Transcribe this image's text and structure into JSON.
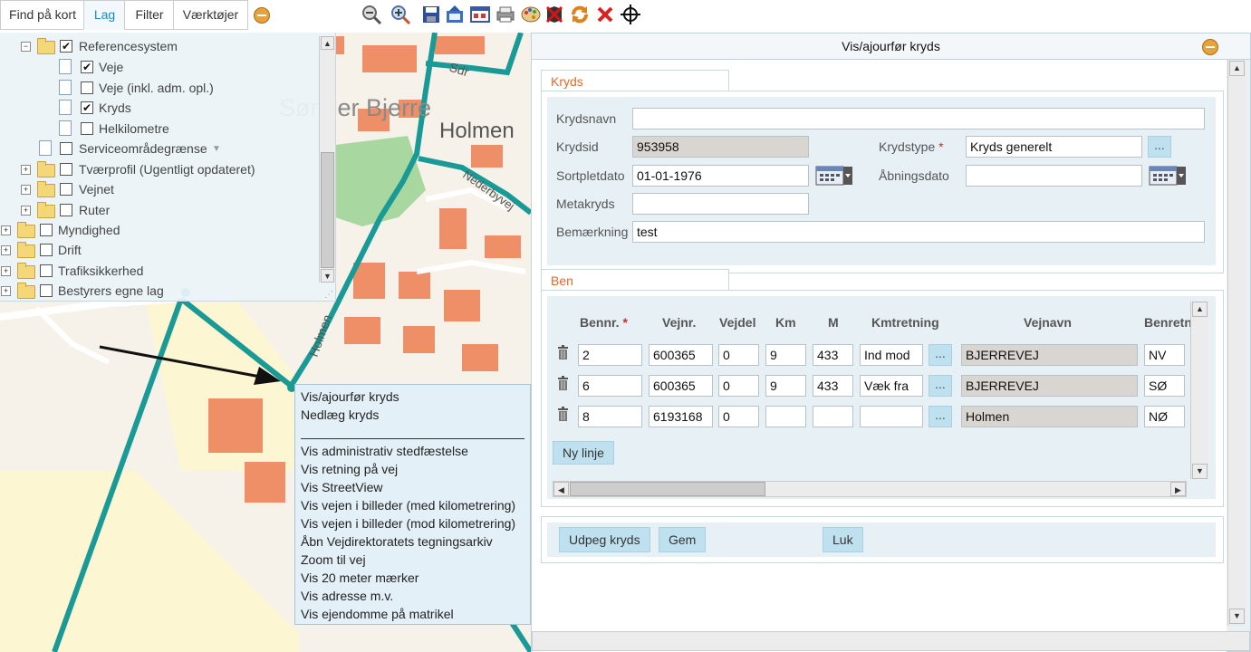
{
  "toolbar": {
    "tabs": [
      {
        "label": "Find på kort",
        "active": false
      },
      {
        "label": "Lag",
        "active": true
      },
      {
        "label": "Filter",
        "active": false
      },
      {
        "label": "Værktøjer",
        "active": false
      }
    ],
    "tools": [
      "zoom-out-icon",
      "zoom-in-icon",
      "save-icon",
      "export-icon",
      "table-icon",
      "print-icon",
      "palette-icon",
      "clear-icon",
      "refresh-icon",
      "close-red-icon",
      "crosshair-icon"
    ]
  },
  "map": {
    "labels": [
      {
        "text": "Sønder Bjerre"
      },
      {
        "text": "Holmen"
      },
      {
        "text": "Sdr"
      },
      {
        "text": "Holmen"
      },
      {
        "text": "Nederbyvej"
      }
    ]
  },
  "layers": [
    {
      "label": "Referencesystem",
      "checked": true
    },
    {
      "label": "Veje",
      "checked": true
    },
    {
      "label": "Veje (inkl. adm. opl.)",
      "checked": false
    },
    {
      "label": "Kryds",
      "checked": true
    },
    {
      "label": "Helkilometre",
      "checked": false
    },
    {
      "label": "Serviceområdegrænse",
      "checked": false
    },
    {
      "label": "Tværprofil (Ugentligt opdateret)",
      "checked": false
    },
    {
      "label": "Vejnet",
      "checked": false
    },
    {
      "label": "Ruter",
      "checked": false
    },
    {
      "label": "Myndighed",
      "checked": false
    },
    {
      "label": "Drift",
      "checked": false
    },
    {
      "label": "Trafiksikkerhed",
      "checked": false
    },
    {
      "label": "Bestyrers egne lag",
      "checked": false
    }
  ],
  "context_menu": {
    "items": [
      "Vis/ajourfør kryds",
      "Nedlæg kryds",
      "Vis administrativ stedfæstelse",
      "Vis retning på vej",
      "Vis StreetView",
      "Vis vejen i billeder (med kilometrering)",
      "Vis vejen i billeder (mod kilometrering)",
      "Åbn Vejdirektoratets tegningsarkiv",
      "Zoom til vej",
      "Vis 20 meter mærker",
      "Vis adresse m.v.",
      "Vis ejendomme på matrikel"
    ]
  },
  "dialog": {
    "title": "Vis/ajourfør kryds",
    "kryds": {
      "tab_label": "Kryds",
      "krydsnavn_label": "Krydsnavn",
      "krydsnavn_value": "",
      "krydsid_label": "Krydsid",
      "krydsid_value": "953958",
      "krydstype_label": "Krydstype",
      "krydstype_value": "Kryds generelt",
      "sortpletdato_label": "Sortpletdato",
      "sortpletdato_value": "01-01-1976",
      "abningsdato_label": "Åbningsdato",
      "abningsdato_value": "",
      "metakryds_label": "Metakryds",
      "metakryds_value": "",
      "bemaerkning_label": "Bemærkning",
      "bemaerkning_value": "test",
      "required_mark": "*",
      "dots": "..."
    },
    "ben": {
      "tab_label": "Ben",
      "headers": [
        "Bennr.",
        "Vejnr.",
        "Vejdel",
        "Km",
        "M",
        "Kmtretning",
        "Vejnavn",
        "Benretn"
      ],
      "required_mark": "*",
      "dots": "...",
      "rows": [
        {
          "bennr": "2",
          "vejnr": "600365",
          "vejdel": "0",
          "km": "9",
          "m": "433",
          "kmtretning": "Ind mod",
          "vejnavn": "BJERREVEJ",
          "benretning": "NV"
        },
        {
          "bennr": "6",
          "vejnr": "600365",
          "vejdel": "0",
          "km": "9",
          "m": "433",
          "kmtretning": "Væk fra",
          "vejnavn": "BJERREVEJ",
          "benretning": "SØ"
        },
        {
          "bennr": "8",
          "vejnr": "6193168",
          "vejdel": "0",
          "km": "",
          "m": "",
          "kmtretning": "",
          "vejnavn": "Holmen",
          "benretning": "NØ"
        }
      ],
      "new_line_label": "Ny linje"
    },
    "buttons": {
      "udpeg": "Udpeg kryds",
      "gem": "Gem",
      "luk": "Luk"
    }
  },
  "colors": {
    "road": "#1a9a96",
    "building": "#ef8f68",
    "accent": "#1a88c8",
    "tab_label": "#e06a2c",
    "button": "#bfe0ee"
  }
}
